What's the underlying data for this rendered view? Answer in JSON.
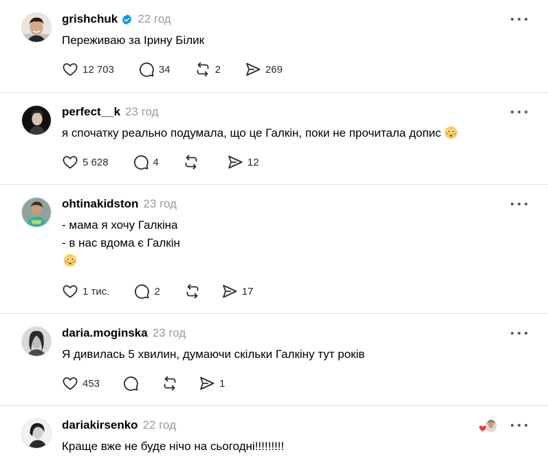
{
  "posts": [
    {
      "username": "grishchuk",
      "verified": true,
      "time": "22 год",
      "lines": [
        "Переживаю за Ірину Білик"
      ],
      "likes": "12 703",
      "replies": "34",
      "reposts": "2",
      "shares": "269"
    },
    {
      "username": "perfect__k",
      "verified": false,
      "time": "23 год",
      "lines": [
        "я спочатку реально подумала, що це Галкін, поки не прочитала допис"
      ],
      "emoji": "flushed-face",
      "likes": "5 628",
      "replies": "4",
      "reposts": "",
      "shares": "12"
    },
    {
      "username": "ohtinakidston",
      "verified": false,
      "time": "23 год",
      "lines": [
        "- мама я хочу Галкіна",
        "- в нас вдома є Галкін"
      ],
      "emoji_line": "flushed-face",
      "likes": "1 тис.",
      "replies": "2",
      "reposts": "",
      "shares": "17"
    },
    {
      "username": "daria.moginska",
      "verified": false,
      "time": "23 год",
      "lines": [
        "Я дивилась 5 хвилин, думаючи скільки Галкіну тут років"
      ],
      "likes": "453",
      "replies": "",
      "reposts": "",
      "shares": "1"
    },
    {
      "username": "dariakirsenko",
      "verified": false,
      "time": "22 год",
      "lines": [
        "Краще вже не буде нічо на сьогодні!!!!!!!!!"
      ],
      "liked_by_author": true
    }
  ],
  "colors": {
    "text": "#000000",
    "muted": "#9a9a9a",
    "verified": "#0095f6",
    "divider": "#e3e3e3",
    "heart": "#ff3040"
  },
  "icons": [
    "heart-icon",
    "comment-icon",
    "repost-icon",
    "share-icon",
    "more-icon",
    "verified-icon"
  ]
}
